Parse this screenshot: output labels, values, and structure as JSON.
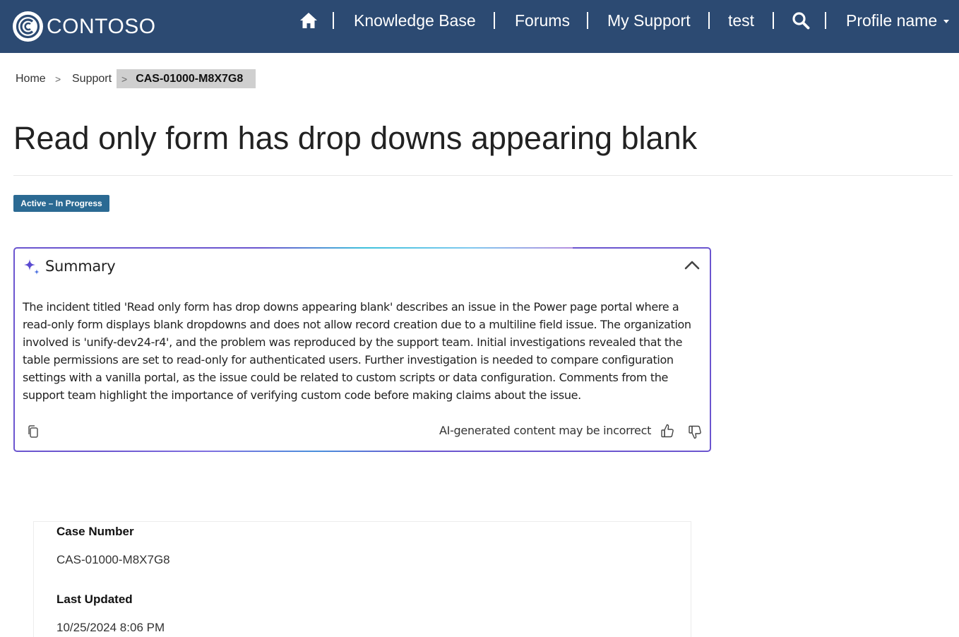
{
  "brand": {
    "name": "CONTOSO"
  },
  "nav": {
    "home_icon": "home-icon",
    "items": [
      "Knowledge Base",
      "Forums",
      "My Support",
      "test"
    ],
    "search_icon": "search-icon",
    "profile": "Profile name"
  },
  "breadcrumb": {
    "items": [
      "Home",
      "Support"
    ],
    "current": "CAS-01000-M8X7G8",
    "separator": ">"
  },
  "page": {
    "title": "Read only form has drop downs appearing blank",
    "status": "Active – In Progress"
  },
  "summary": {
    "title": "Summary",
    "body": "The incident titled 'Read only form has drop downs appearing blank' describes an issue in the Power page portal where a read-only form displays blank dropdowns and does not allow record creation due to a multiline field issue. The organization involved is 'unify-dev24-r4', and the problem was reproduced by the support team. Initial investigations revealed that the table permissions are set to read-only for authenticated users. Further investigation is needed to compare configuration settings with a vanilla portal, as the issue could be related to custom scripts or data configuration. Comments from the support team highlight the importance of verifying custom code before making claims about the issue.",
    "disclaimer": "AI-generated content may be incorrect"
  },
  "details": {
    "case_number_label": "Case Number",
    "case_number": "CAS-01000-M8X7G8",
    "last_updated_label": "Last Updated",
    "last_updated": "10/25/2024 8:06 PM"
  },
  "colors": {
    "header_bg": "#2c4a72",
    "status_badge": "#2b6a93",
    "summary_border": "#6b55cf"
  }
}
